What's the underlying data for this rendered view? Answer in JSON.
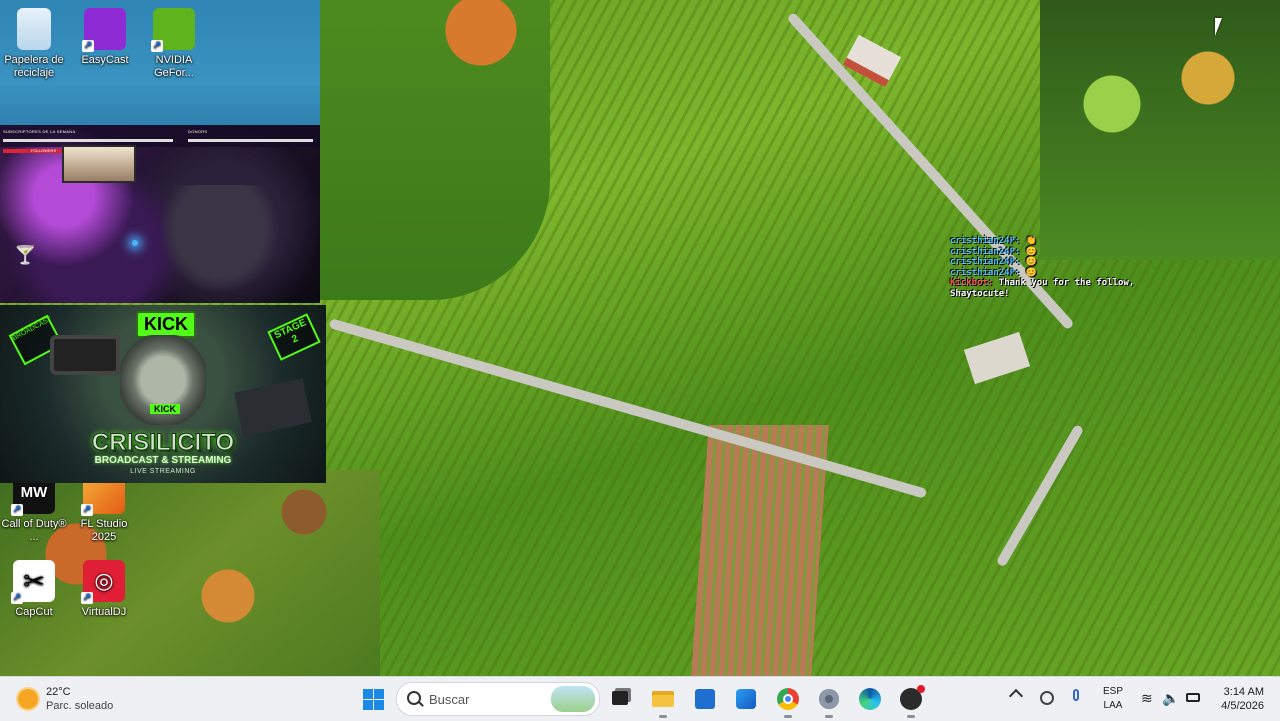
{
  "desktop": {
    "icons": [
      {
        "label": "Papelera de reciclaje"
      },
      {
        "label": "EasyCast"
      },
      {
        "label": "NVIDIA GeFor..."
      },
      {
        "label": "Call of Duty® ..."
      },
      {
        "label": "FL Studio 2025"
      },
      {
        "label": "CapCut"
      },
      {
        "label": "VirtualDJ"
      }
    ]
  },
  "overlay": {
    "cam_header_left": "SUBSCRIPTORES DE LA SEMANA",
    "cam_header_right": "DONORS",
    "cam_followers": "FOLLOWERS",
    "banner": {
      "kick_top": "KICK",
      "kick_mid": "KICK",
      "tag_left": "BROADCAST",
      "tag_right": "STAGE 2",
      "name": "CRISILICITO",
      "sub1": "BROADCAST & STREAMING",
      "sub2": "LIVE STREAMING"
    },
    "chat": [
      {
        "user": "cristhian24P:",
        "message": "👏"
      },
      {
        "user": "cristhian24P:",
        "message": "😊"
      },
      {
        "user": "cristhian24P:",
        "message": "😊"
      },
      {
        "user": "cristhian24P:",
        "message": "😊"
      },
      {
        "user": "Kickbot:",
        "message": "Thank you for the follow,"
      },
      {
        "user": "",
        "message": "Shaytocute!"
      }
    ]
  },
  "taskbar": {
    "weather_temp": "22°C",
    "weather_desc": "Parc. soleado",
    "search_placeholder": "Buscar",
    "apps": [
      "file-explorer-icon",
      "explorer-folder-icon",
      "store-icon",
      "outlook-icon",
      "chrome-icon",
      "settings-icon",
      "edge-icon",
      "obs-icon"
    ],
    "lang_top": "ESP",
    "lang_bottom": "LAA",
    "time": "3:14 AM",
    "date": "4/5/2026"
  },
  "colors": {
    "accent": "#1a8ae6",
    "kick_green": "#53fc18",
    "taskbar_bg": "#eef0f4"
  }
}
